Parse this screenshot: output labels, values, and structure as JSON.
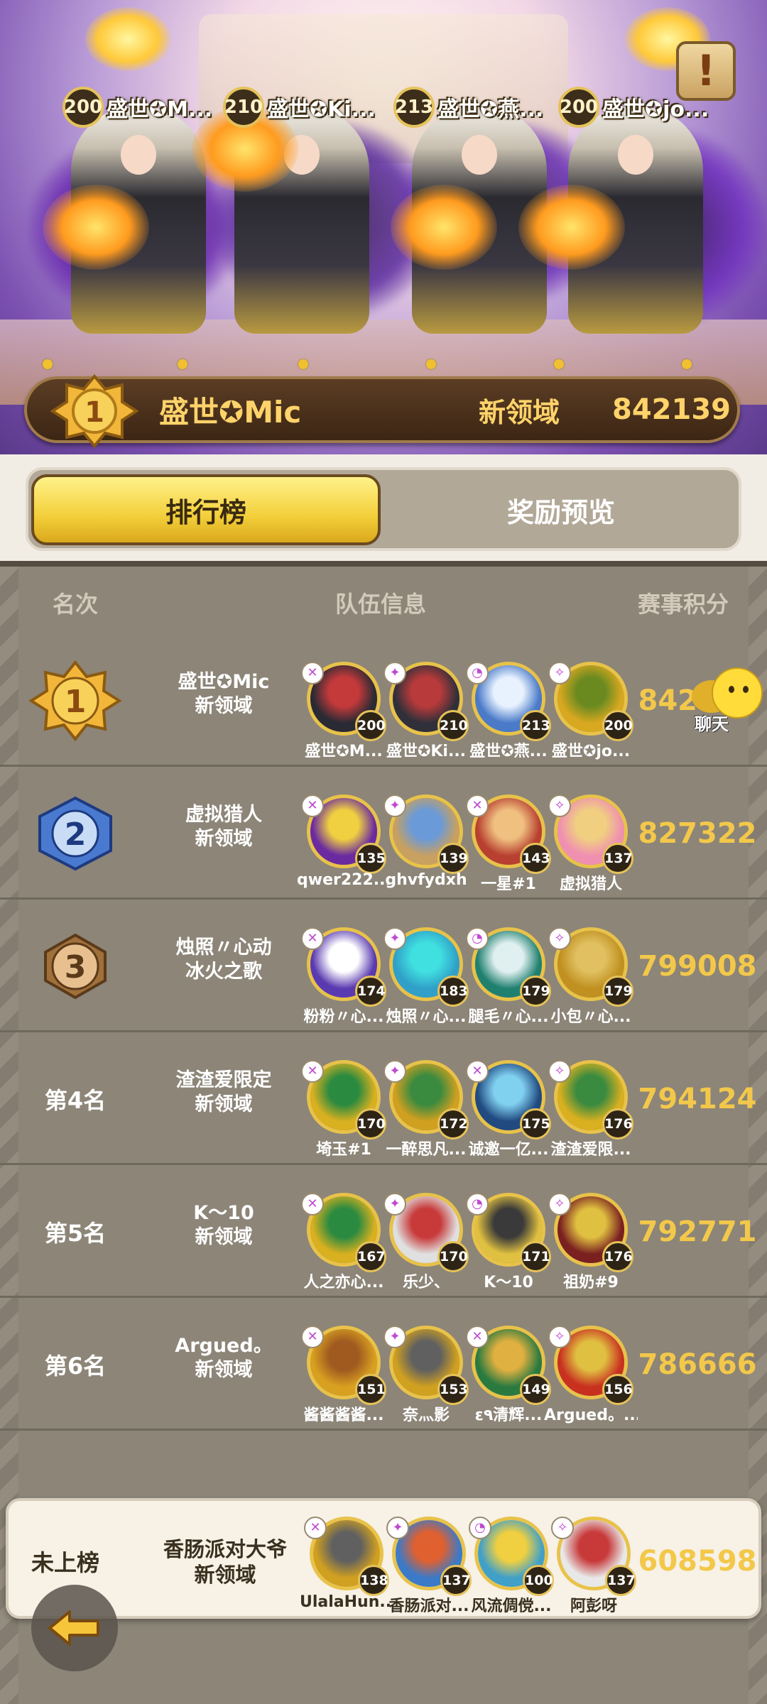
{
  "hero": {
    "notice_icon": "exclamation-scroll-icon",
    "top_players": [
      {
        "level": "200",
        "name": "盛世✪M..."
      },
      {
        "level": "210",
        "name": "盛世✪Ki..."
      },
      {
        "level": "213",
        "name": "盛世✪燕..."
      },
      {
        "level": "200",
        "name": "盛世✪jo..."
      }
    ],
    "champion": {
      "rank": "1",
      "name": "盛世✪Mic",
      "server": "新领域",
      "score": "842139"
    }
  },
  "tabs": {
    "leaderboard": "排行榜",
    "rewards": "奖励预览"
  },
  "header": {
    "rank": "名次",
    "team": "队伍信息",
    "score": "赛事积分"
  },
  "chat": {
    "label": "聊天"
  },
  "rows": [
    {
      "rank": "1",
      "team": "盛世✪Mic",
      "server": "新领域",
      "score": "842139",
      "members": [
        {
          "level": "200",
          "name": "盛世✪M..."
        },
        {
          "level": "210",
          "name": "盛世✪Ki..."
        },
        {
          "level": "213",
          "name": "盛世✪燕..."
        },
        {
          "level": "200",
          "name": "盛世✪jo..."
        }
      ]
    },
    {
      "rank": "2",
      "team": "虚拟猎人",
      "server": "新领域",
      "score": "827322",
      "members": [
        {
          "level": "135",
          "name": "qwer222..."
        },
        {
          "level": "139",
          "name": "ghvfydxh"
        },
        {
          "level": "143",
          "name": "一星#1"
        },
        {
          "level": "137",
          "name": "虚拟猎人"
        }
      ]
    },
    {
      "rank": "3",
      "team": "烛照〃心动",
      "server": "冰火之歌",
      "score": "799008",
      "members": [
        {
          "level": "174",
          "name": "粉粉〃心..."
        },
        {
          "level": "183",
          "name": "烛照〃心..."
        },
        {
          "level": "179",
          "name": "腿毛〃心..."
        },
        {
          "level": "179",
          "name": "小包〃心..."
        }
      ]
    },
    {
      "rank": "第4名",
      "team": "渣渣爱限定",
      "server": "新领域",
      "score": "794124",
      "members": [
        {
          "level": "170",
          "name": "埼玉#1"
        },
        {
          "level": "172",
          "name": "一醉思凡..."
        },
        {
          "level": "175",
          "name": "诚邀一亿..."
        },
        {
          "level": "176",
          "name": "渣渣爱限..."
        }
      ]
    },
    {
      "rank": "第5名",
      "team": "K～10",
      "server": "新领域",
      "score": "792771",
      "members": [
        {
          "level": "167",
          "name": "人之亦心..."
        },
        {
          "level": "170",
          "name": "乐少、"
        },
        {
          "level": "171",
          "name": "K～10"
        },
        {
          "level": "176",
          "name": "祖奶#9"
        }
      ]
    },
    {
      "rank": "第6名",
      "team": "Argued。",
      "server": "新领域",
      "score": "786666",
      "members": [
        {
          "level": "151",
          "name": "酱酱酱酱..."
        },
        {
          "level": "153",
          "name": "奈灬影"
        },
        {
          "level": "149",
          "name": "ε٩清辉..."
        },
        {
          "level": "156",
          "name": "Argued。..."
        }
      ]
    }
  ],
  "self_row": {
    "rank": "未上榜",
    "team": "香肠派对大爷",
    "server": "新领域",
    "score": "608598",
    "members": [
      {
        "level": "138",
        "name": "UlalaHun..."
      },
      {
        "level": "137",
        "name": "香肠派对..."
      },
      {
        "level": "100",
        "name": "风流倜傥..."
      },
      {
        "level": "137",
        "name": "阿彭呀"
      }
    ]
  },
  "back_button": {
    "icon": "back-arrow-icon"
  }
}
